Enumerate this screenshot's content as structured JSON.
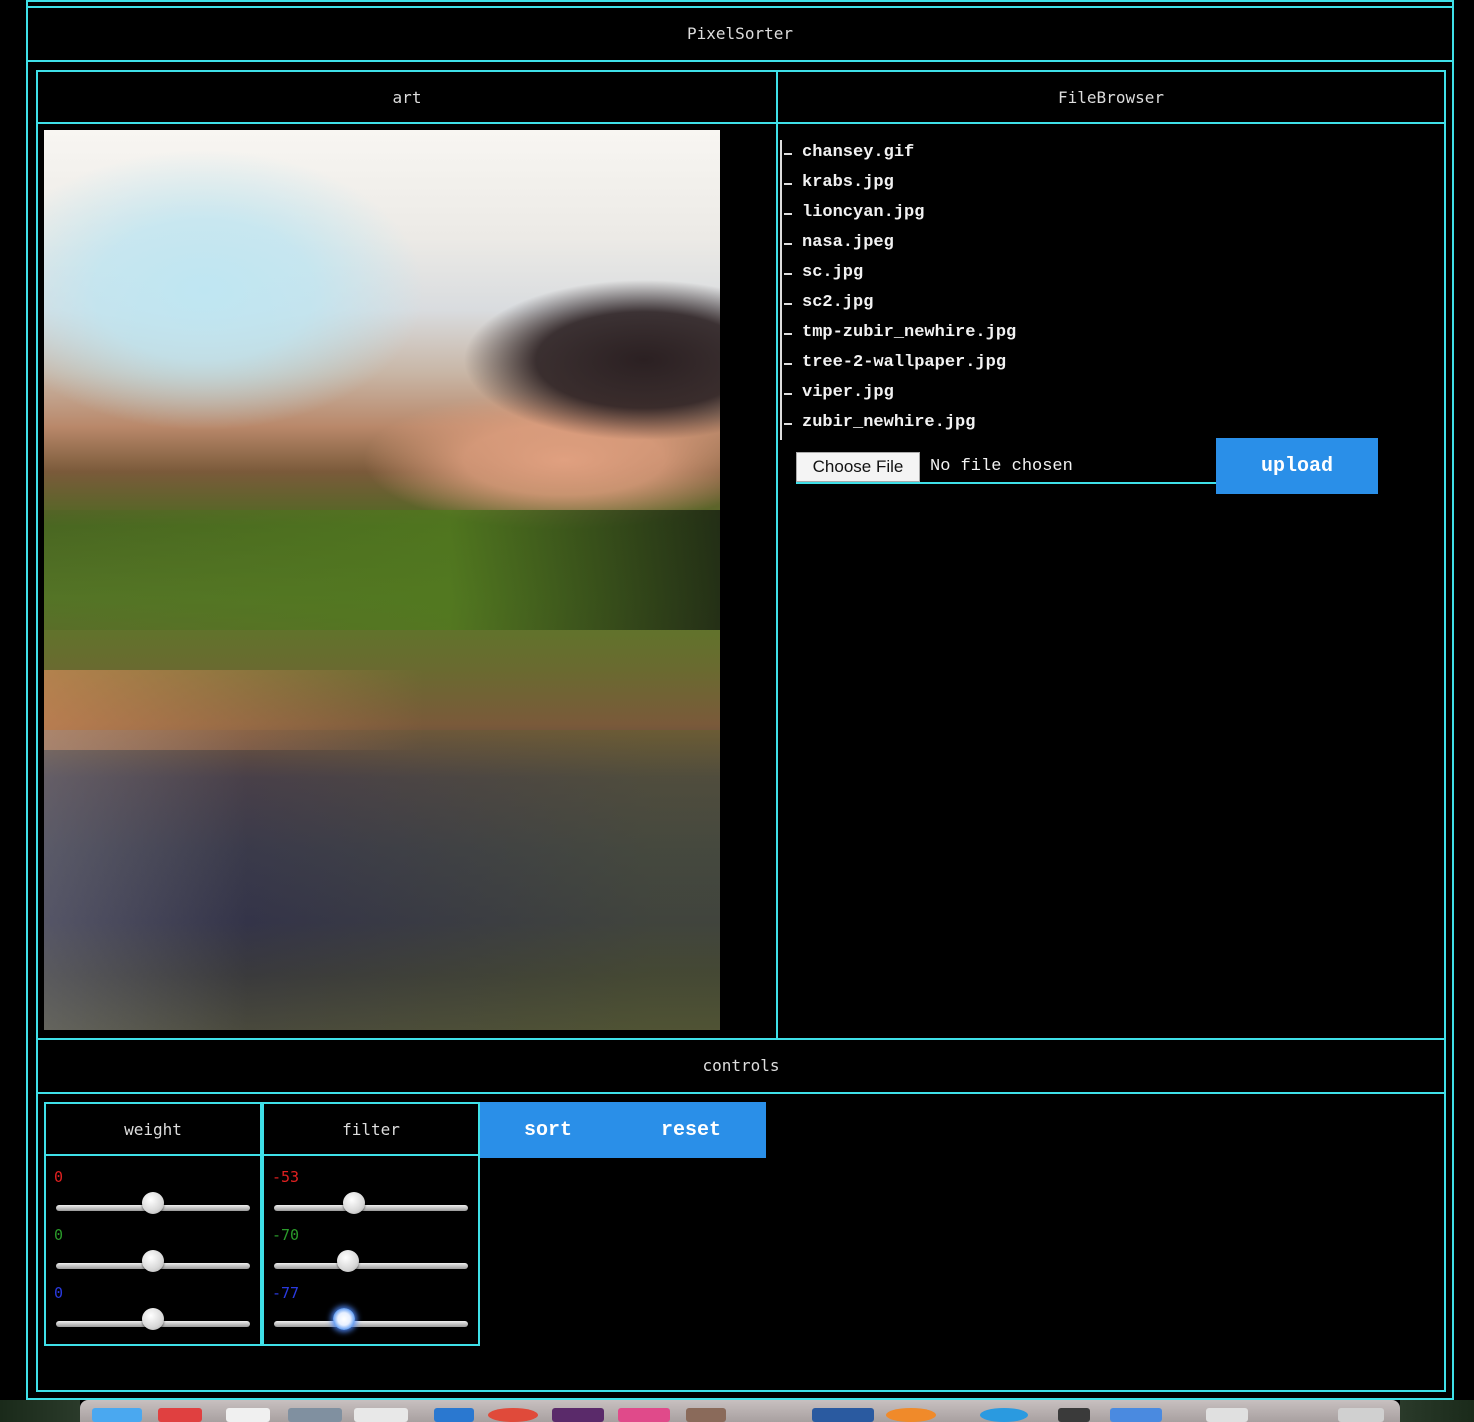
{
  "app": {
    "title": "PixelSorter"
  },
  "panels": {
    "art": {
      "title": "art"
    },
    "file_browser": {
      "title": "FileBrowser",
      "files": [
        "chansey.gif",
        "krabs.jpg",
        "lioncyan.jpg",
        "nasa.jpeg",
        "sc.jpg",
        "sc2.jpg",
        "tmp-zubir_newhire.jpg",
        "tree-2-wallpaper.jpg",
        "viper.jpg",
        "zubir_newhire.jpg"
      ],
      "choose_file_label": "Choose File",
      "no_file_text": "No file chosen",
      "upload_label": "upload"
    },
    "controls": {
      "title": "controls",
      "weight": {
        "title": "weight",
        "sliders": [
          {
            "value": "0",
            "color": "#e02020",
            "fraction": 0.5
          },
          {
            "value": "0",
            "color": "#2a9a2a",
            "fraction": 0.5
          },
          {
            "value": "0",
            "color": "#2a3ae0",
            "fraction": 0.5
          }
        ]
      },
      "filter": {
        "title": "filter",
        "sliders": [
          {
            "value": "-53",
            "color": "#e02020",
            "fraction": 0.41
          },
          {
            "value": "-70",
            "color": "#2a9a2a",
            "fraction": 0.38
          },
          {
            "value": "-77",
            "color": "#2a3ae0",
            "fraction": 0.36
          }
        ]
      },
      "sort_label": "sort",
      "reset_label": "reset"
    }
  },
  "colors": {
    "accent_border": "#3fe0e8",
    "button_blue": "#2a8fe8",
    "background": "#000000"
  }
}
